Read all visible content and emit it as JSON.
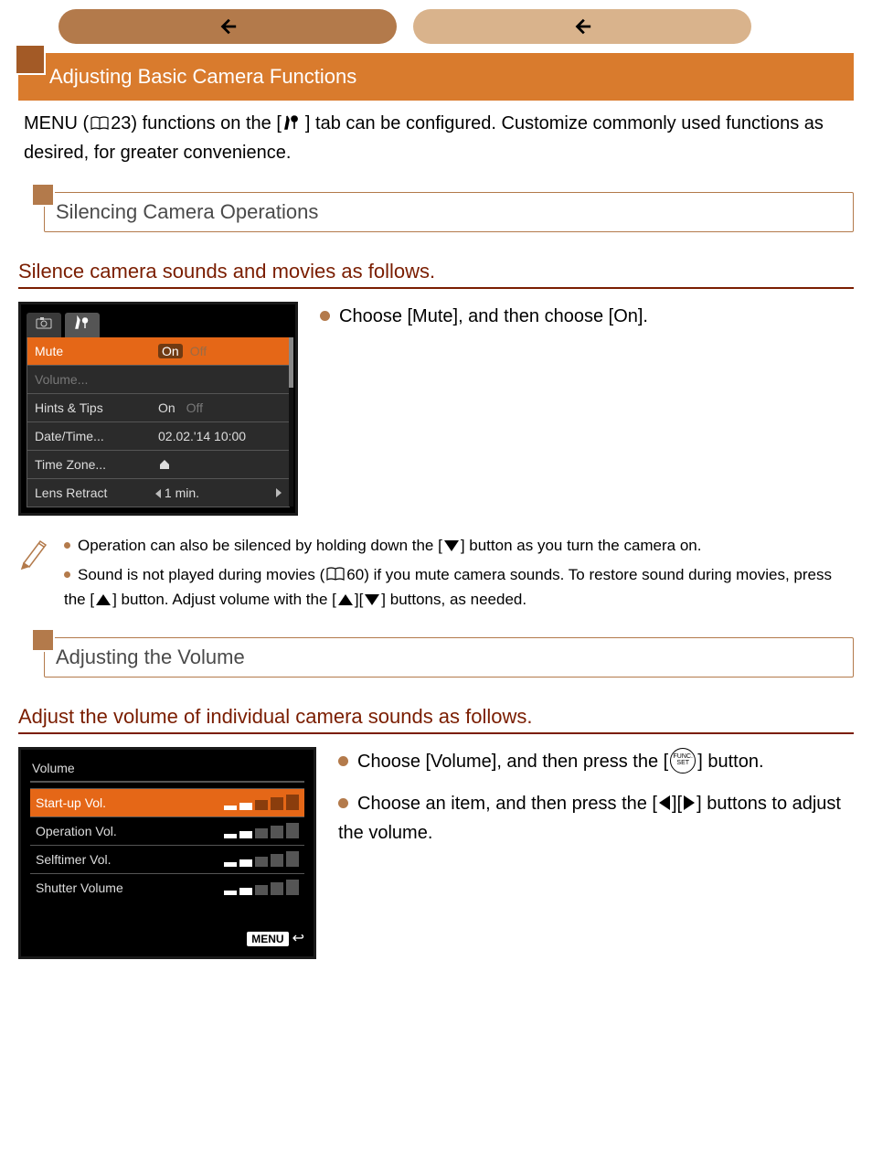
{
  "chips": [
    "",
    ""
  ],
  "banner": "Adjusting Basic Camera Functions",
  "pageref1": "23",
  "intro_a": "MENU (",
  "intro_b": ") functions on the [",
  "intro_c": "] tab can be configured. Customize commonly used functions as desired, for greater convenience.",
  "section1": "Silencing Camera Operations",
  "h3_1": "Silence camera sounds and movies as follows.",
  "bullet1": "Choose [Mute], and then choose [On].",
  "lcd1": {
    "rows": [
      {
        "label": "Mute",
        "value_on": "On",
        "value_off": "Off",
        "sel": true
      },
      {
        "label": "Volume...",
        "dim": true
      },
      {
        "label": "Hints & Tips",
        "value_on": "On",
        "value_off": "Off"
      },
      {
        "label": "Date/Time...",
        "value": "02.02.'14 10:00"
      },
      {
        "label": "Time Zone...",
        "value_icon": "home"
      },
      {
        "label": "Lens Retract",
        "value": "1 min.",
        "arrows": true
      }
    ]
  },
  "note1": "Operation can also be silenced by holding down the [    ] button as you turn the camera on.",
  "note2a": "Sound is not played during movies (",
  "note2ref": "60",
  "note2b": ") if you mute camera sounds. To restore sound during movies, press the [    ] button. Adjust volume with the [    ][    ] buttons, as needed.",
  "section2": "Adjusting the Volume",
  "h3_2": "Adjust the volume of individual camera sounds as follows.",
  "vol_bullet1a": "Choose [Volume], and then press the [",
  "vol_bullet1b": "] button.",
  "vol_bullet2a": "Choose an item, and then press the [",
  "vol_bullet2b": "][",
  "vol_bullet2c": "] buttons to adjust the volume.",
  "vlcd": {
    "title": "Volume",
    "rows": [
      {
        "label": "Start-up Vol.",
        "level": 2,
        "sel": true
      },
      {
        "label": "Operation Vol.",
        "level": 2
      },
      {
        "label": "Selftimer Vol.",
        "level": 2
      },
      {
        "label": "Shutter Volume",
        "level": 2
      }
    ],
    "menu": "MENU"
  }
}
